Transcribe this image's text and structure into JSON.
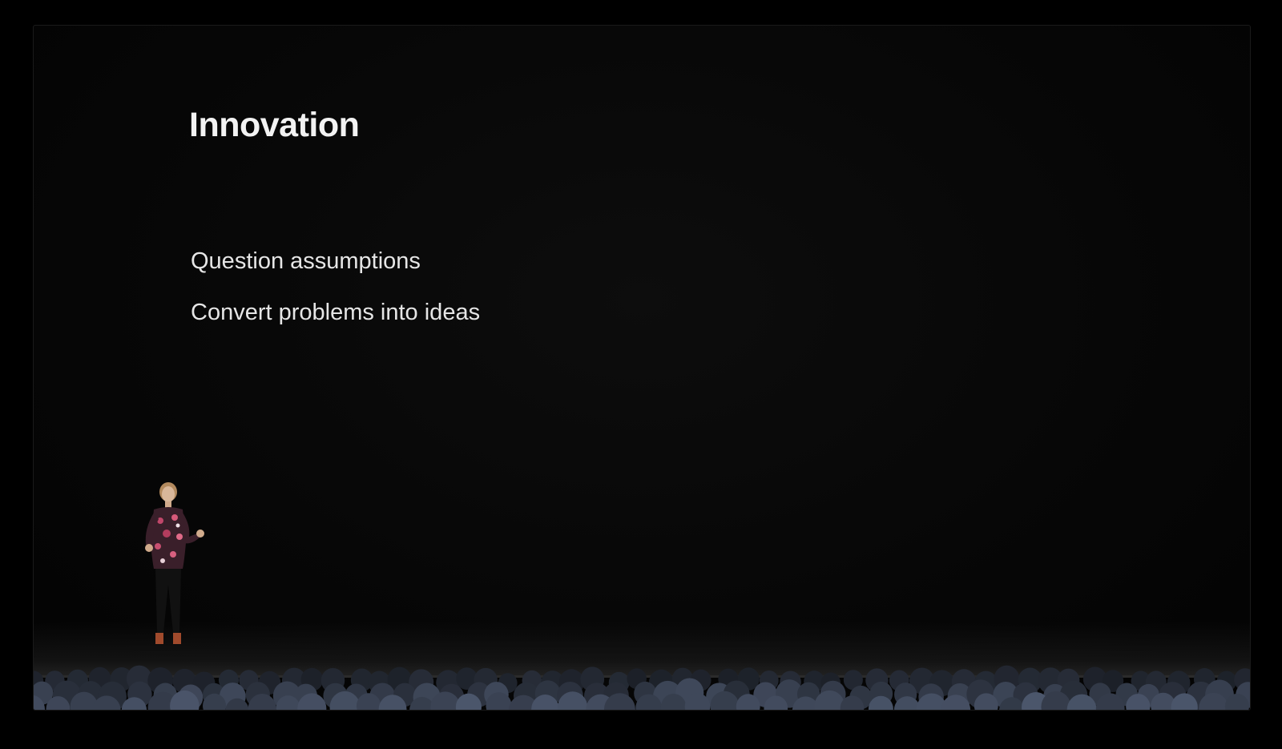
{
  "slide": {
    "title": "Innovation",
    "bullets": [
      "Question assumptions",
      "Convert problems into ideas"
    ]
  },
  "colors": {
    "background": "#000000",
    "slide_text": "#f2f2f2",
    "audience_heads": "#5a6a82"
  },
  "icons": {
    "presenter": "presenter-figure",
    "audience": "audience-silhouettes"
  }
}
